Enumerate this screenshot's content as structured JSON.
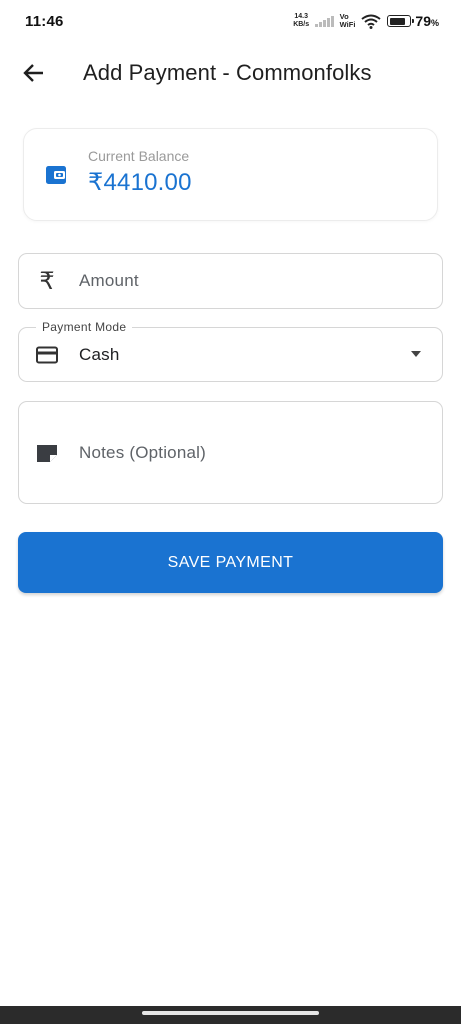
{
  "status_bar": {
    "time": "11:46",
    "net_speed_value": "14.3",
    "net_speed_unit": "KB/s",
    "vo": "Vo",
    "wifi_label": "WiFi",
    "battery_percent": "79",
    "battery_symbol": "%",
    "battery_level": 0.79
  },
  "app_bar": {
    "back_icon": "arrow-back-icon",
    "title": "Add Payment - Commonfolks"
  },
  "balance_card": {
    "icon": "wallet-icon",
    "label": "Current Balance",
    "value": "₹4410.00"
  },
  "form": {
    "amount": {
      "icon": "rupee-icon",
      "rupee_glyph": "₹",
      "placeholder": "Amount"
    },
    "payment_mode": {
      "icon": "credit-card-icon",
      "label": "Payment Mode",
      "value": "Cash"
    },
    "notes": {
      "icon": "note-icon",
      "placeholder": "Notes (Optional)"
    }
  },
  "save_button": {
    "label": "SAVE PAYMENT"
  },
  "colors": {
    "accent": "#1a73d1",
    "border": "#d6d6d6",
    "text_primary": "#202124",
    "text_secondary": "#5f6368"
  }
}
